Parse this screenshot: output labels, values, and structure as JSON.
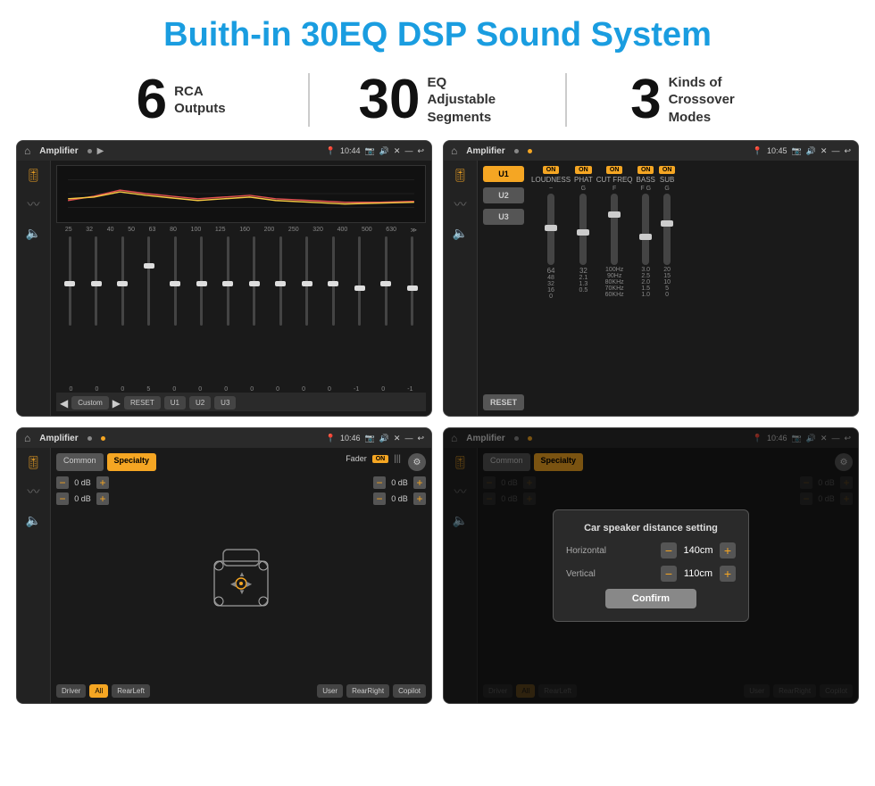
{
  "page": {
    "title": "Buith-in 30EQ DSP Sound System"
  },
  "stats": [
    {
      "number": "6",
      "label": "RCA\nOutputs"
    },
    {
      "number": "30",
      "label": "EQ Adjustable\nSegments"
    },
    {
      "number": "3",
      "label": "Kinds of\nCrossover Modes"
    }
  ],
  "screens": {
    "screen1": {
      "status_bar": {
        "title": "Amplifier",
        "time": "10:44"
      },
      "eq_frequencies": [
        "25",
        "32",
        "40",
        "50",
        "63",
        "80",
        "100",
        "125",
        "160",
        "200",
        "250",
        "320",
        "400",
        "500",
        "630"
      ],
      "eq_values": [
        "0",
        "0",
        "0",
        "5",
        "0",
        "0",
        "0",
        "0",
        "0",
        "0",
        "0",
        "-1",
        "0",
        "-1"
      ],
      "presets": [
        "Custom",
        "RESET",
        "U1",
        "U2",
        "U3"
      ]
    },
    "screen2": {
      "status_bar": {
        "title": "Amplifier",
        "time": "10:45"
      },
      "presets": [
        "U1",
        "U2",
        "U3"
      ],
      "channels": [
        {
          "label": "LOUDNESS",
          "on": true
        },
        {
          "label": "PHAT",
          "on": true
        },
        {
          "label": "CUT FREQ",
          "on": true
        },
        {
          "label": "BASS",
          "on": true
        },
        {
          "label": "SUB",
          "on": true
        }
      ],
      "reset_label": "RESET"
    },
    "screen3": {
      "status_bar": {
        "title": "Amplifier",
        "time": "10:46"
      },
      "tabs": [
        "Common",
        "Specialty"
      ],
      "fader_label": "Fader",
      "fader_on": "ON",
      "db_values": [
        "0 dB",
        "0 dB",
        "0 dB",
        "0 dB"
      ],
      "bottom_buttons": [
        "Driver",
        "RearLeft",
        "All",
        "User",
        "RearRight",
        "Copilot"
      ]
    },
    "screen4": {
      "status_bar": {
        "title": "Amplifier",
        "time": "10:46"
      },
      "tabs": [
        "Common",
        "Specialty"
      ],
      "dialog": {
        "title": "Car speaker distance setting",
        "horizontal_label": "Horizontal",
        "horizontal_value": "140cm",
        "vertical_label": "Vertical",
        "vertical_value": "110cm",
        "confirm_label": "Confirm"
      },
      "db_values_right": [
        "0 dB",
        "0 dB"
      ],
      "bottom_buttons": [
        "Driver",
        "RearLeft",
        "All",
        "User",
        "RearRight",
        "Copilot"
      ]
    }
  }
}
